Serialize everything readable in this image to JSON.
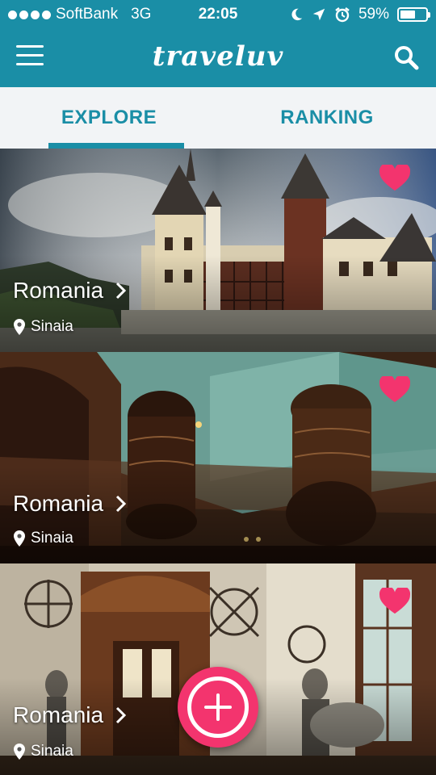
{
  "status_bar": {
    "carrier": "SoftBank",
    "network": "3G",
    "time": "22:05",
    "battery": "59%",
    "battery_level": 0.59
  },
  "header": {
    "title": "traveluv",
    "icons": [
      "menu-icon",
      "search-icon"
    ]
  },
  "tabs": [
    {
      "label": "EXPLORE",
      "active": true
    },
    {
      "label": "RANKING",
      "active": false
    }
  ],
  "feed": [
    {
      "country": "Romania",
      "city": "Sinaia",
      "favorited": true
    },
    {
      "country": "Romania",
      "city": "Sinaia",
      "favorited": true
    },
    {
      "country": "Romania",
      "city": "Sinaia",
      "favorited": true
    }
  ],
  "colors": {
    "brand": "#1a8ea6",
    "heart": "#f3346e",
    "tab_bg": "#f2f4f6"
  },
  "fab": {
    "icon": "plus-icon"
  }
}
